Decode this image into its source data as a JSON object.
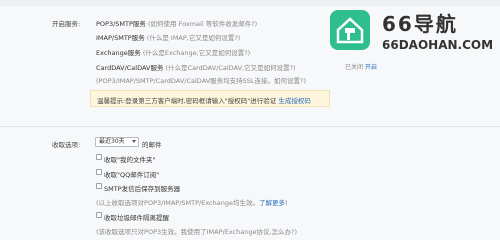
{
  "account_settings": {
    "section_label": "开启服务:",
    "services": [
      {
        "name": "POP3/SMTP服务",
        "note": "(如何使用 Foxmail 等软件收发邮件?)"
      },
      {
        "name": "IMAP/SMTP服务",
        "note": "(什么是 IMAP,它又是如何设置?)"
      },
      {
        "name": "Exchange服务",
        "note": "(什么是Exchange,它又是如何设置?)"
      },
      {
        "name": "CardDAV/CalDAV服务",
        "note": "(什么是CardDAV/CalDAV,它又是如何设置?)"
      }
    ],
    "ssl_note": "(POP3/IMAP/SMTP/CardDAV/CalDAV服务均支持SSL连接。如何设置?)",
    "side_status": "已关闭",
    "side_action": "开启",
    "notice": {
      "prefix": "温馨提示:登录第三方客户端时,密码框请输入\"授权码\"进行验证",
      "link": "生成授权码"
    }
  },
  "receive_options": {
    "label": "收取选项:",
    "range_select": "最近30天",
    "range_suffix": "的邮件",
    "checkboxes": [
      {
        "label": "收取\"我的文件夹\""
      },
      {
        "label": "收取\"QQ邮件订阅\""
      },
      {
        "label": "SMTP发信后保存到服务器"
      }
    ],
    "smtp_note_prefix": "(以上收取选项对POP3/IMAP/SMTP/Exchange均生效。",
    "smtp_note_link": "了解更多",
    "smtp_note_suffix": ")",
    "spam_checkbox": "收取垃圾邮件隔离提醒",
    "footer_note": "(该收取选项只对POP3生效。我使用了IMAP/Exchange协议,怎么办?)"
  },
  "watermark": {
    "title": "66导航",
    "url": "66DAOHAN.COM"
  },
  "colors": {
    "link": "#2a6ebb",
    "notice_bg": "#fdf6dd",
    "logo_green": "#2fbf8f"
  }
}
